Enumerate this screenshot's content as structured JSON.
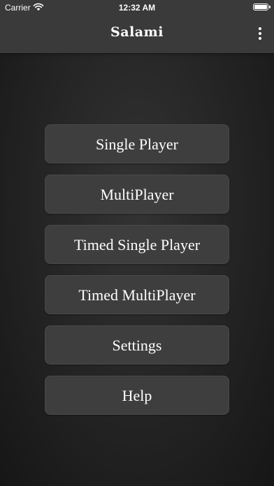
{
  "status_bar": {
    "carrier": "Carrier",
    "time": "12:32 AM",
    "icons": [
      "wifi-icon",
      "battery-icon"
    ]
  },
  "nav": {
    "title": "Salami",
    "more_icon": "more-vertical-icon"
  },
  "menu": {
    "items": [
      {
        "label": "Single Player"
      },
      {
        "label": "MultiPlayer"
      },
      {
        "label": "Timed Single Player"
      },
      {
        "label": "Timed MultiPlayer"
      },
      {
        "label": "Settings"
      },
      {
        "label": "Help"
      }
    ]
  },
  "colors": {
    "bar": "#3a3a3a",
    "background": "#262626",
    "button": "#3e3e3e",
    "text": "#ffffff"
  }
}
